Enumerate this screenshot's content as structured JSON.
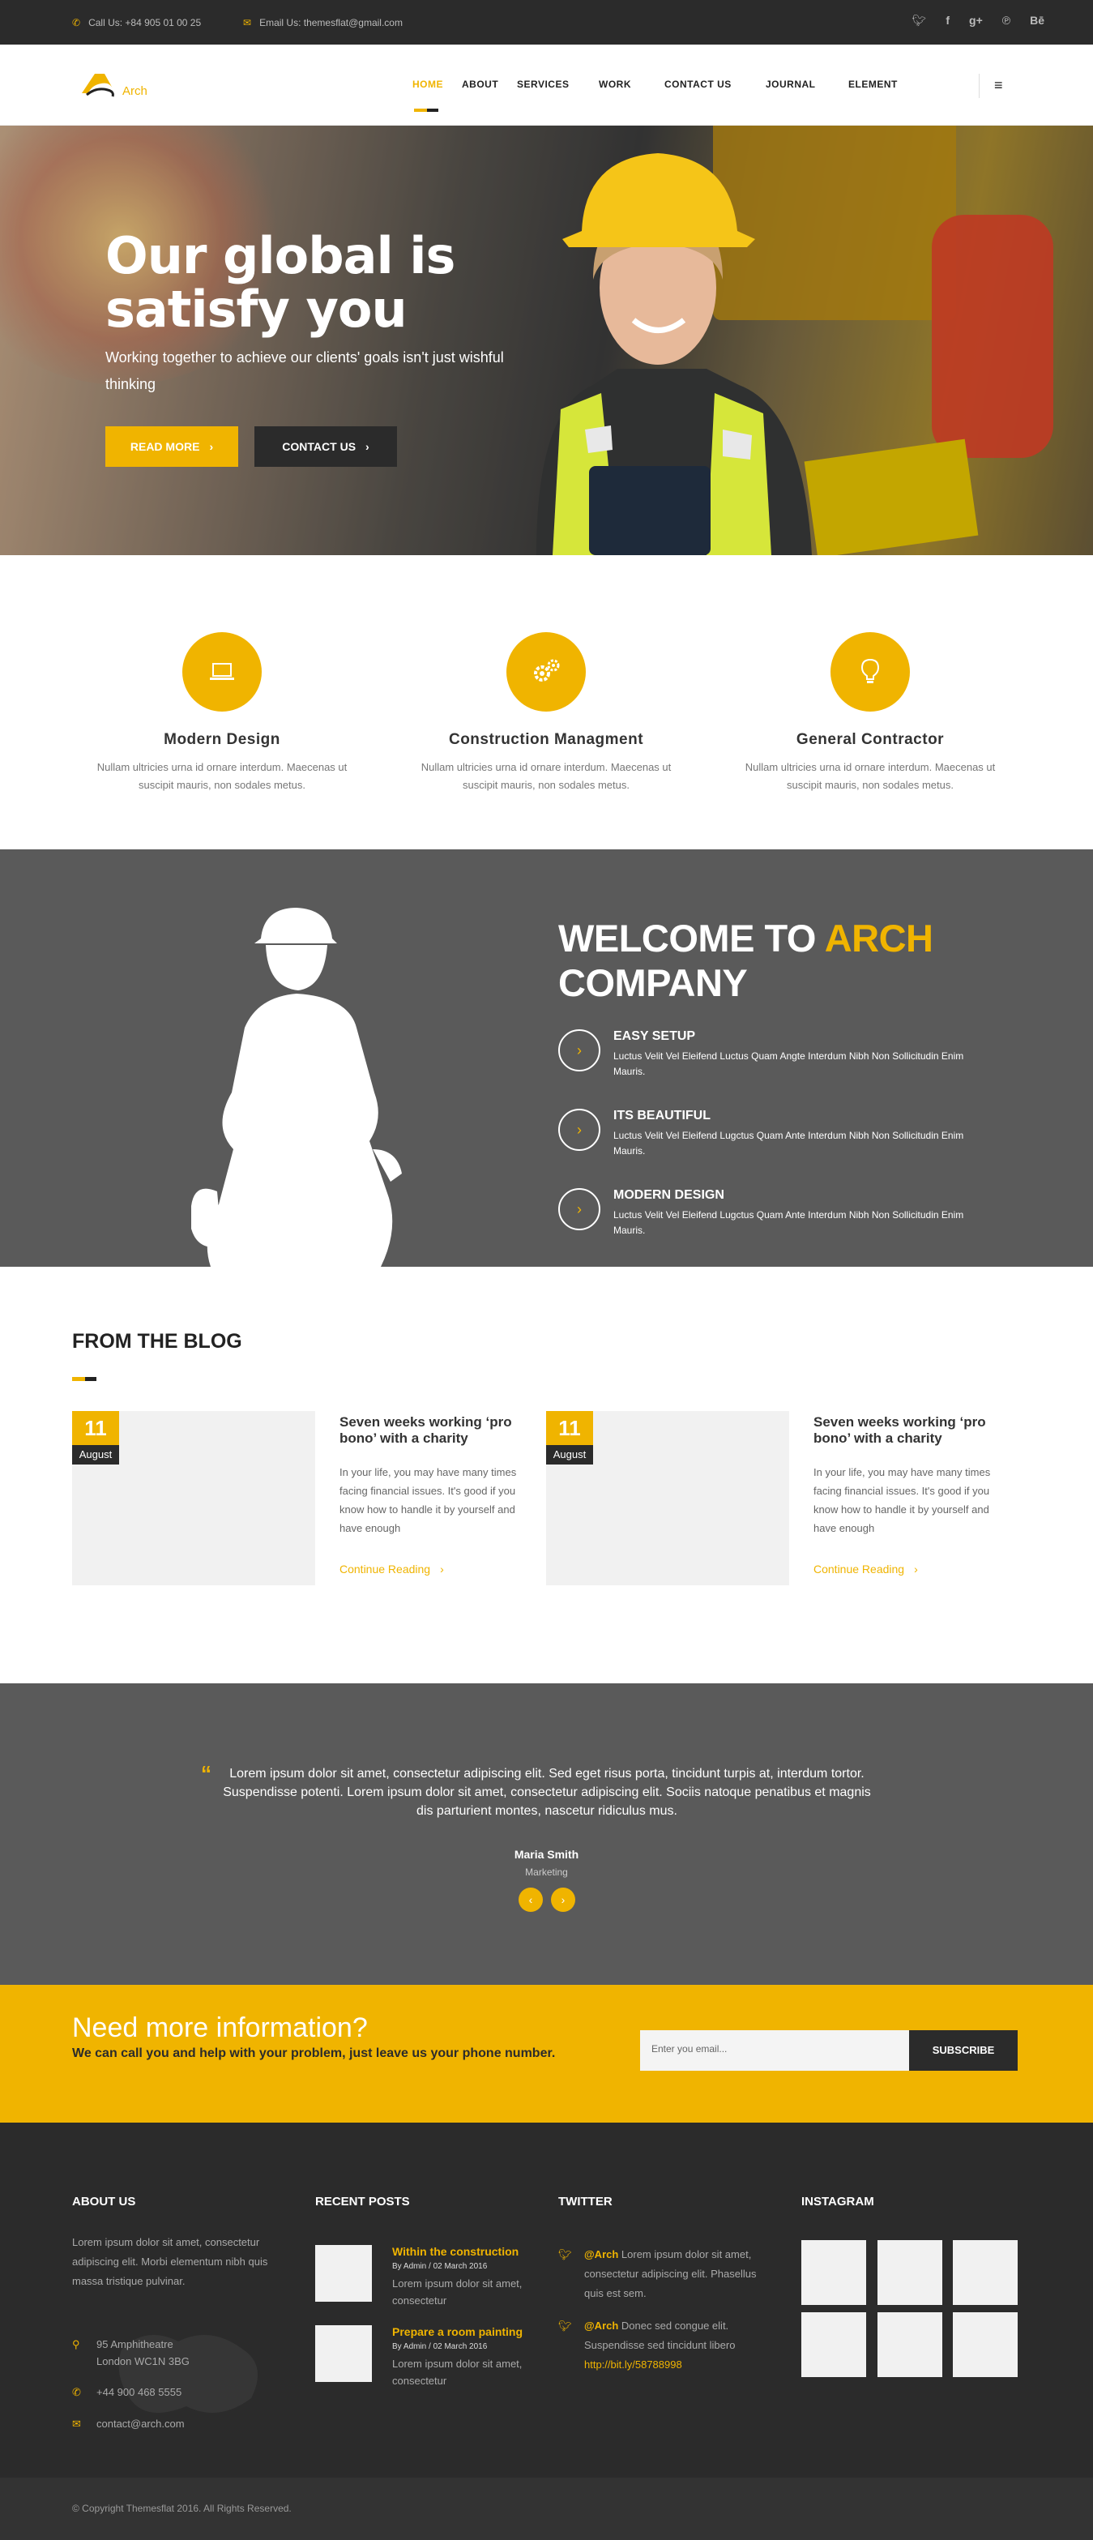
{
  "topbar": {
    "phone": "Call Us: +84 905 01 00 25",
    "email": "Email Us: themesflat@gmail.com",
    "social": [
      "twitter-icon",
      "facebook-icon",
      "google-plus-icon",
      "pinterest-icon",
      "behance-icon"
    ]
  },
  "header": {
    "logo_text": "Arch",
    "nav": [
      "HOME",
      "ABOUT",
      "SERVICES",
      "WORK",
      "CONTACT US",
      "JOURNAL",
      "ELEMENT"
    ],
    "menu_icon": "≡"
  },
  "hero": {
    "title": "Our global is satisfy you",
    "subtitle": "Working together to achieve our clients' goals isn't just wishful thinking",
    "read_more": "READ MORE",
    "contact": "CONTACT US"
  },
  "features": [
    {
      "title": "Modern Design",
      "text": "Nullam ultricies urna id ornare interdum. Maecenas ut suscipit mauris, non sodales metus.",
      "icon": "laptop-icon"
    },
    {
      "title": "Construction Managment",
      "text": "Nullam ultricies urna id ornare interdum. Maecenas ut suscipit mauris, non sodales metus.",
      "icon": "gears-icon"
    },
    {
      "title": "General Contractor",
      "text": "Nullam ultricies urna id ornare interdum. Maecenas ut suscipit mauris, non sodales metus.",
      "icon": "lightbulb-icon"
    }
  ],
  "welcome": {
    "title_pre": "WELCOME TO ",
    "title_accent": "ARCH",
    "title_post": "COMPANY",
    "items": [
      {
        "title": "EASY SETUP",
        "text": "Luctus Velit Vel Eleifend Luctus Quam Angte Interdum Nibh Non Sollicitudin Enim Mauris."
      },
      {
        "title": "ITS BEAUTIFUL",
        "text": "Luctus Velit Vel Eleifend Lugctus Quam Ante Interdum Nibh Non Sollicitudin Enim Mauris."
      },
      {
        "title": "MODERN DESIGN",
        "text": "Luctus Velit Vel Eleifend Lugctus Quam Ante Interdum Nibh Non Sollicitudin Enim Mauris."
      }
    ]
  },
  "blog": {
    "title": "FROM THE BLOG",
    "posts": [
      {
        "day": "11",
        "month": "August",
        "title": "Seven weeks working ‘pro bono’ with a charity",
        "excerpt": "In your life, you may have many times facing financial issues. It's good if you know how to handle it by yourself and have enough",
        "link": "Continue Reading"
      },
      {
        "day": "11",
        "month": "August",
        "title": "Seven weeks working ‘pro bono’ with a charity",
        "excerpt": "In your life, you may have many times facing financial issues. It's good if you know how to handle it by yourself and have enough",
        "link": "Continue Reading"
      }
    ]
  },
  "testimonial": {
    "quote_mark": "“",
    "text": "Lorem ipsum dolor sit amet, consectetur adipiscing elit. Sed eget risus porta, tincidunt turpis at, interdum tortor. Suspendisse potenti. Lorem ipsum dolor sit amet, consectetur adipiscing elit. Sociis natoque penatibus et magnis dis parturient montes, nascetur ridiculus mus.",
    "name": "Maria Smith",
    "role": "Marketing",
    "prev": "‹",
    "next": "›"
  },
  "cta": {
    "title": "Need more information?",
    "text": "We can call you and help with your problem, just leave us your phone number.",
    "placeholder": "Enter you email...",
    "button": "SUBSCRIBE"
  },
  "footer": {
    "about_title": "ABOUT US",
    "about_text": "Lorem ipsum dolor sit amet, consectetur adipiscing elit. Morbi elementum nibh quis massa tristique pulvinar.",
    "address_line1": "95 Amphitheatre",
    "address_line2": "London WC1N 3BG",
    "phone": "+44 900 468 5555",
    "email": "contact@arch.com",
    "recent_title": "RECENT POSTS",
    "recent": [
      {
        "title": "Within the construction",
        "meta": "By Admin / 02 March 2016",
        "text": "Lorem ipsum dolor sit amet, consectetur"
      },
      {
        "title": "Prepare a room painting",
        "meta": "By Admin / 02 March 2016",
        "text": "Lorem ipsum dolor sit amet, consectetur"
      }
    ],
    "twitter_title": "TWITTER",
    "tweets": [
      {
        "user": "@Arch",
        "text": " Lorem ipsum dolor sit amet, consectetur adipiscing elit. Phasellus quis est sem.",
        "link": ""
      },
      {
        "user": "@Arch",
        "text": " Donec sed congue elit. Suspendisse sed tincidunt libero",
        "link": "http://bit.ly/58788998"
      }
    ],
    "instagram_title": "INSTAGRAM",
    "copyright": "© Copyright Themesflat 2016. All Rights Reserved."
  }
}
